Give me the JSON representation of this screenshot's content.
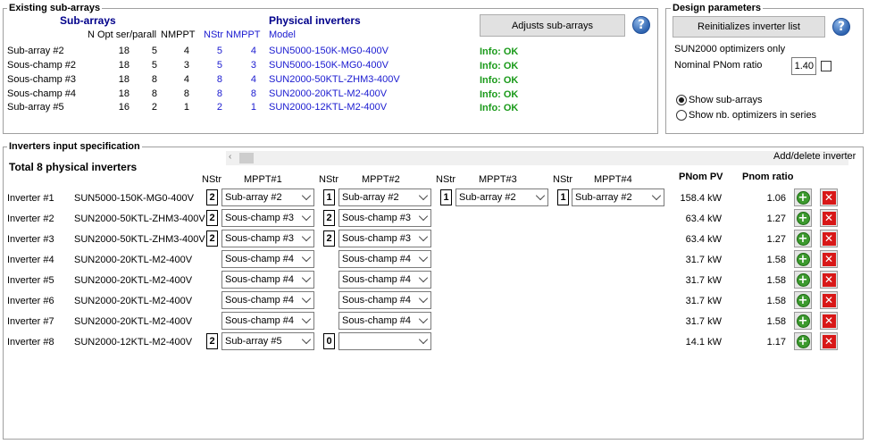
{
  "existing": {
    "title": "Existing sub-arrays",
    "subarrays_label": "Sub-arrays",
    "physinv_label": "Physical inverters",
    "col_nopt": "N Opt ser/parall",
    "col_nmppt": "NMPPT",
    "col_nstr": "NStr",
    "col_nmppt2": "NMPPT",
    "col_model": "Model",
    "adjust_button": "Adjusts sub-arrays",
    "rows": [
      {
        "name": "Sub-array #2",
        "nser": "18",
        "npar": "5",
        "nmppt": "4",
        "nstr": "5",
        "nmppt2": "4",
        "model": "SUN5000-150K-MG0-400V",
        "info": "Info: OK"
      },
      {
        "name": "Sous-champ #2",
        "nser": "18",
        "npar": "5",
        "nmppt": "3",
        "nstr": "5",
        "nmppt2": "3",
        "model": "SUN5000-150K-MG0-400V",
        "info": "Info: OK"
      },
      {
        "name": "Sous-champ #3",
        "nser": "18",
        "npar": "8",
        "nmppt": "4",
        "nstr": "8",
        "nmppt2": "4",
        "model": "SUN2000-50KTL-ZHM3-400V",
        "info": "Info: OK"
      },
      {
        "name": "Sous-champ #4",
        "nser": "18",
        "npar": "8",
        "nmppt": "8",
        "nstr": "8",
        "nmppt2": "8",
        "model": "SUN2000-20KTL-M2-400V",
        "info": "Info: OK"
      },
      {
        "name": "Sub-array #5",
        "nser": "16",
        "npar": "2",
        "nmppt": "1",
        "nstr": "2",
        "nmppt2": "1",
        "model": "SUN2000-12KTL-M2-400V",
        "info": "Info: OK"
      }
    ]
  },
  "design": {
    "title": "Design parameters",
    "reinit_button": "Reinitializes inverter list",
    "optimizers_only": "SUN2000 optimizers only",
    "pnom_label": "Nominal PNom ratio",
    "pnom_value": "1.40",
    "radio_subarrays": "Show sub-arrays",
    "radio_optimizers": "Show nb. optimizers in series"
  },
  "spec": {
    "title": "Inverters input specification",
    "add_delete": "Add/delete inverter",
    "total": "Total 8 physical inverters",
    "hdr_nstr": "NStr",
    "hdr_mppt1": "MPPT#1",
    "hdr_mppt2": "MPPT#2",
    "hdr_mppt3": "MPPT#3",
    "hdr_mppt4": "MPPT#4",
    "hdr_pnom": "PNom PV",
    "hdr_ratio": "Pnom ratio",
    "rows": [
      {
        "name": "Inverter #1",
        "model": "SUN5000-150K-MG0-400V",
        "m": [
          {
            "n": "2",
            "v": "Sub-array #2"
          },
          {
            "n": "1",
            "v": "Sub-array #2"
          },
          {
            "n": "1",
            "v": "Sub-array #2"
          },
          {
            "n": "1",
            "v": "Sub-array #2"
          }
        ],
        "pnom": "158.4 kW",
        "ratio": "1.06"
      },
      {
        "name": "Inverter #2",
        "model": "SUN2000-50KTL-ZHM3-400V",
        "m": [
          {
            "n": "2",
            "v": "Sous-champ #3"
          },
          {
            "n": "2",
            "v": "Sous-champ #3"
          }
        ],
        "pnom": "63.4 kW",
        "ratio": "1.27"
      },
      {
        "name": "Inverter #3",
        "model": "SUN2000-50KTL-ZHM3-400V",
        "m": [
          {
            "n": "2",
            "v": "Sous-champ #3"
          },
          {
            "n": "2",
            "v": "Sous-champ #3"
          }
        ],
        "pnom": "63.4 kW",
        "ratio": "1.27"
      },
      {
        "name": "Inverter #4",
        "model": "SUN2000-20KTL-M2-400V",
        "m": [
          {
            "n": "",
            "v": "Sous-champ #4"
          },
          {
            "n": "",
            "v": "Sous-champ #4"
          }
        ],
        "pnom": "31.7 kW",
        "ratio": "1.58"
      },
      {
        "name": "Inverter #5",
        "model": "SUN2000-20KTL-M2-400V",
        "m": [
          {
            "n": "",
            "v": "Sous-champ #4"
          },
          {
            "n": "",
            "v": "Sous-champ #4"
          }
        ],
        "pnom": "31.7 kW",
        "ratio": "1.58"
      },
      {
        "name": "Inverter #6",
        "model": "SUN2000-20KTL-M2-400V",
        "m": [
          {
            "n": "",
            "v": "Sous-champ #4"
          },
          {
            "n": "",
            "v": "Sous-champ #4"
          }
        ],
        "pnom": "31.7 kW",
        "ratio": "1.58"
      },
      {
        "name": "Inverter #7",
        "model": "SUN2000-20KTL-M2-400V",
        "m": [
          {
            "n": "",
            "v": "Sous-champ #4"
          },
          {
            "n": "",
            "v": "Sous-champ #4"
          }
        ],
        "pnom": "31.7 kW",
        "ratio": "1.58"
      },
      {
        "name": "Inverter #8",
        "model": "SUN2000-12KTL-M2-400V",
        "m": [
          {
            "n": "2",
            "v": "Sub-array #5"
          },
          {
            "n": "0",
            "v": ""
          }
        ],
        "pnom": "14.1 kW",
        "ratio": "1.17"
      }
    ]
  }
}
